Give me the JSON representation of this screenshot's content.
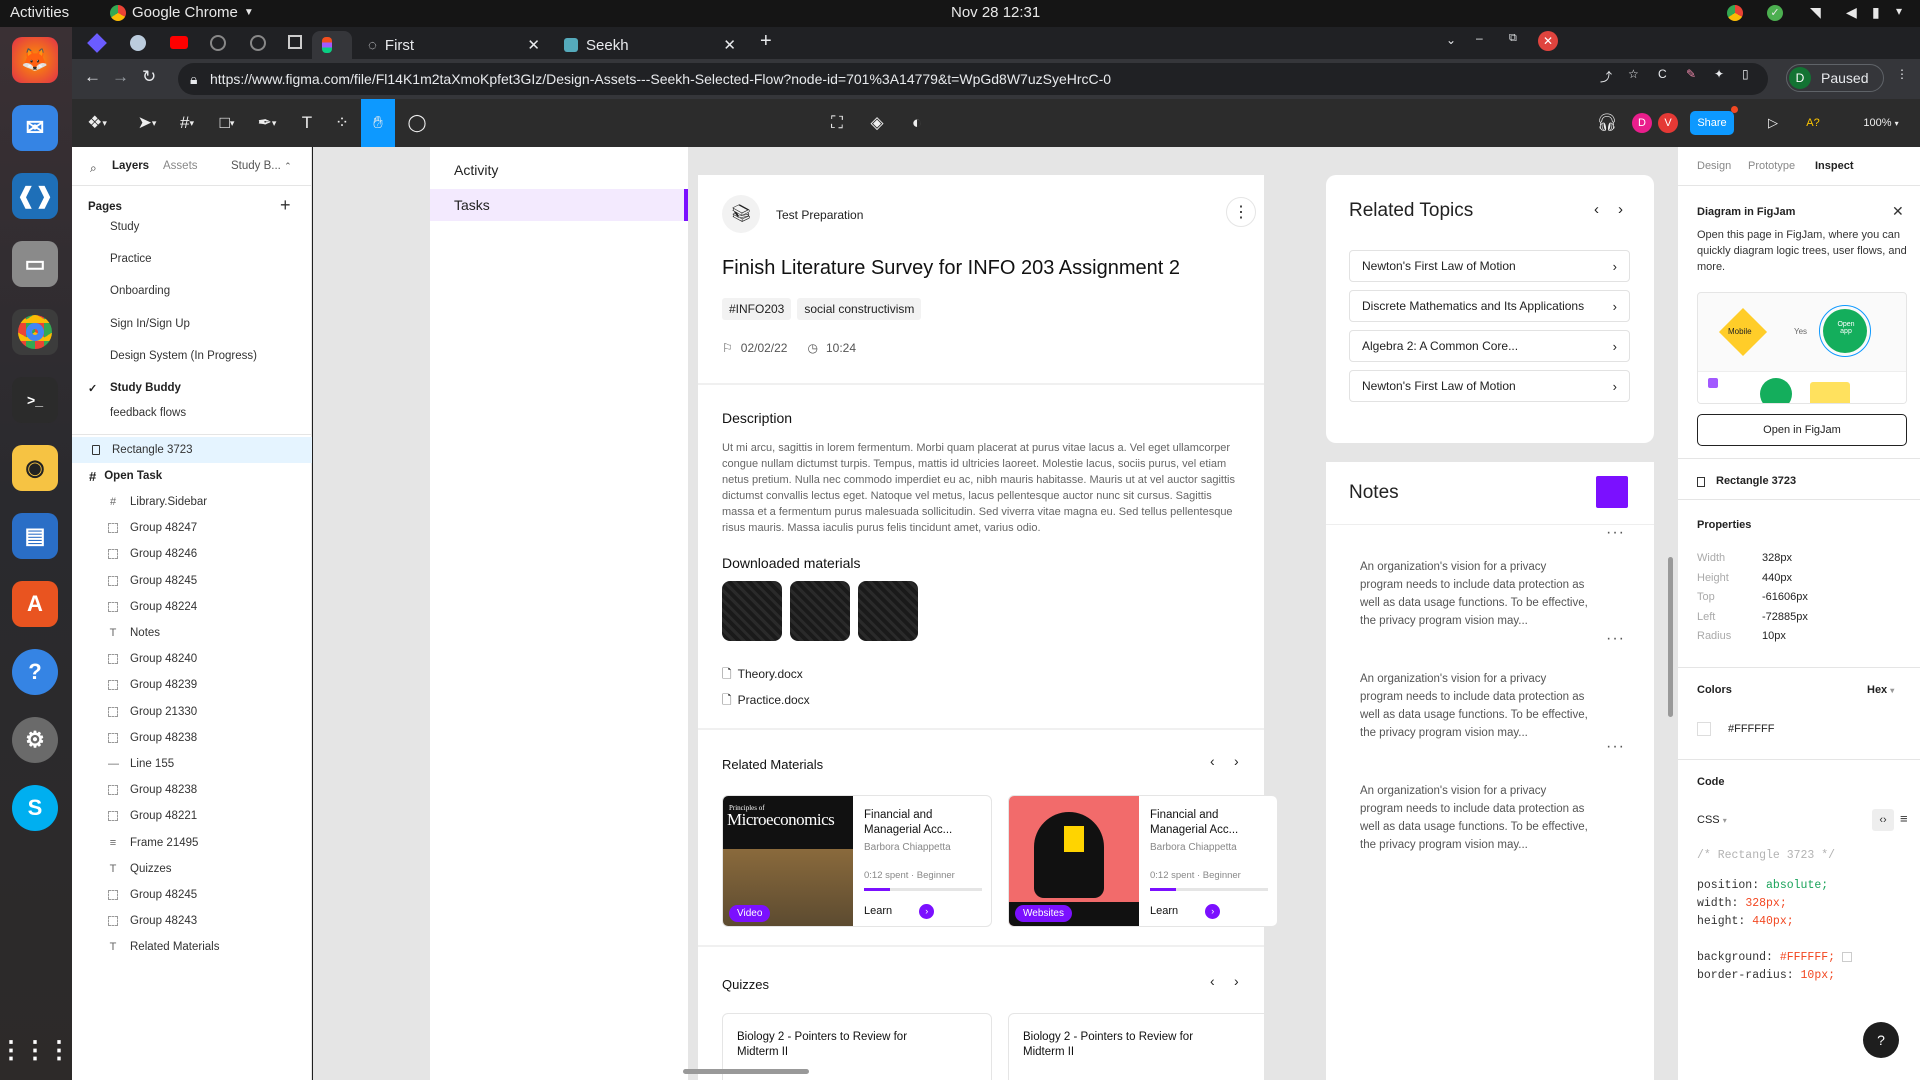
{
  "os": {
    "activities": "Activities",
    "app": "Google Chrome",
    "datetime": "Nov 28  12:31"
  },
  "browser": {
    "tabs": [
      {
        "label": "First"
      },
      {
        "label": "Seekh"
      }
    ],
    "url": "https://www.figma.com/file/Fl14K1m2taXmoKpfet3GIz/Design-Assets---Seekh-Selected-Flow?node-id=701%3A14779&t=WpGd8W7uzSyeHrcC-0",
    "profile_status": "Paused",
    "profile_initial": "D"
  },
  "figma": {
    "share": "Share",
    "zoom": "100%",
    "avatars": [
      "D",
      "V"
    ],
    "access": "A?",
    "left_tabs": [
      "Layers",
      "Assets",
      "Study B..."
    ],
    "pages_title": "Pages",
    "pages": [
      "Study",
      "Practice",
      "Onboarding",
      "Sign In/Sign Up",
      "Design System (In Progress)",
      "Study Buddy",
      "feedback flows"
    ],
    "selected_layer": "Rectangle 3723",
    "frame_layer": "Open Task",
    "layers": [
      "Library.Sidebar",
      "Group 48247",
      "Group 48246",
      "Group 48245",
      "Group 48224",
      "Notes",
      "Group 48240",
      "Group 48239",
      "Group 21330",
      "Group 48238",
      "Line 155",
      "Group 48238",
      "Group 48221",
      "Frame 21495",
      "Quizzes",
      "Group 48245",
      "Group 48243",
      "Related Materials"
    ],
    "right_tabs": [
      "Design",
      "Prototype",
      "Inspect"
    ],
    "figjam": {
      "title": "Diagram in FigJam",
      "desc": "Open this page in FigJam, where you can quickly diagram logic trees, user flows, and more.",
      "mobile": "Mobile",
      "yes": "Yes",
      "open_app": "Open app",
      "button": "Open in FigJam"
    },
    "selection_name": "Rectangle 3723",
    "properties_title": "Properties",
    "properties": [
      {
        "k": "Width",
        "v": "328px"
      },
      {
        "k": "Height",
        "v": "440px"
      },
      {
        "k": "Top",
        "v": "-61606px"
      },
      {
        "k": "Left",
        "v": "-72885px"
      },
      {
        "k": "Radius",
        "v": "10px"
      }
    ],
    "colors_title": "Colors",
    "color_mode": "Hex",
    "color_value": "#FFFFFF",
    "code_title": "Code",
    "code_lang": "CSS",
    "code": {
      "comment": "/* Rectangle 3723 */",
      "l1k": "position:",
      "l1v": "absolute;",
      "l2k": "width:",
      "l2v": "328px;",
      "l3k": "height:",
      "l3v": "440px;",
      "l4k": "background:",
      "l4v": "#FFFFFF;",
      "l5k": "border-radius:",
      "l5v": "10px;"
    },
    "help": "?"
  },
  "app": {
    "sidebar": [
      "Activity",
      "Tasks"
    ],
    "task": {
      "category": "Test Preparation",
      "title": "Finish Literature Survey for INFO 203 Assignment 2",
      "tags": [
        "#INFO203",
        "social constructivism"
      ],
      "date": "02/02/22",
      "time": "10:24",
      "desc_title": "Description",
      "desc": "Ut mi arcu, sagittis in lorem fermentum. Morbi quam placerat at purus vitae lacus a. Vel eget ullamcorper congue nullam dictumst turpis. Tempus, mattis id ultricies laoreet. Molestie lacus, sociis purus, vel etiam netus pretium. Nulla nec commodo imperdiet eu ac, nibh mauris habitasse. Mauris ut at vel auctor sagittis dictumst convallis lectus eget. Natoque vel metus, lacus pellentesque auctor nunc sit cursus. Sagittis massa et a fermentum purus malesuada sollicitudin. Sed viverra vitae magna eu. Sed tellus pellentesque risus mauris. Massa iaculis purus felis tincidunt amet, varius odio.",
      "downloads_title": "Downloaded materials",
      "files": [
        "Theory.docx",
        "Practice.docx"
      ],
      "related_title": "Related Materials",
      "related": [
        {
          "title": "Financial and Managerial Acc...",
          "author": "Barbora Chiappetta",
          "meta": "0:12 spent · Beginner",
          "learn": "Learn",
          "badge": "Video",
          "cover_top": "Principles of",
          "cover": "Microeconomics"
        },
        {
          "title": "Financial and Managerial Acc...",
          "author": "Barbora Chiappetta",
          "meta": "0:12 spent · Beginner",
          "learn": "Learn",
          "badge": "Websites"
        }
      ],
      "quizzes_title": "Quizzes",
      "quizzes": [
        "Biology 2 - Pointers to Review for Midterm II",
        "Biology 2 - Pointers to Review for Midterm II"
      ]
    },
    "topics_title": "Related Topics",
    "topics": [
      "Newton's First Law of Motion",
      "Discrete Mathematics and Its Applications",
      "Algebra 2: A Common Core...",
      "Newton's First Law of Motion"
    ],
    "notes_title": "Notes",
    "notes": [
      "An organization's vision for a privacy program needs to include data protection as well as data usage functions. To be effective, the privacy program vision may...",
      "An organization's vision for a privacy program needs to include data protection as well as data usage functions. To be effective, the privacy program vision may...",
      "An organization's vision for a privacy program needs to include data protection as well as data usage functions. To be effective, the privacy program vision may..."
    ]
  },
  "colors": {
    "accent": "#7b10ff",
    "figma_blue": "#0d99ff",
    "selected_bg": "#e5f4ff"
  }
}
